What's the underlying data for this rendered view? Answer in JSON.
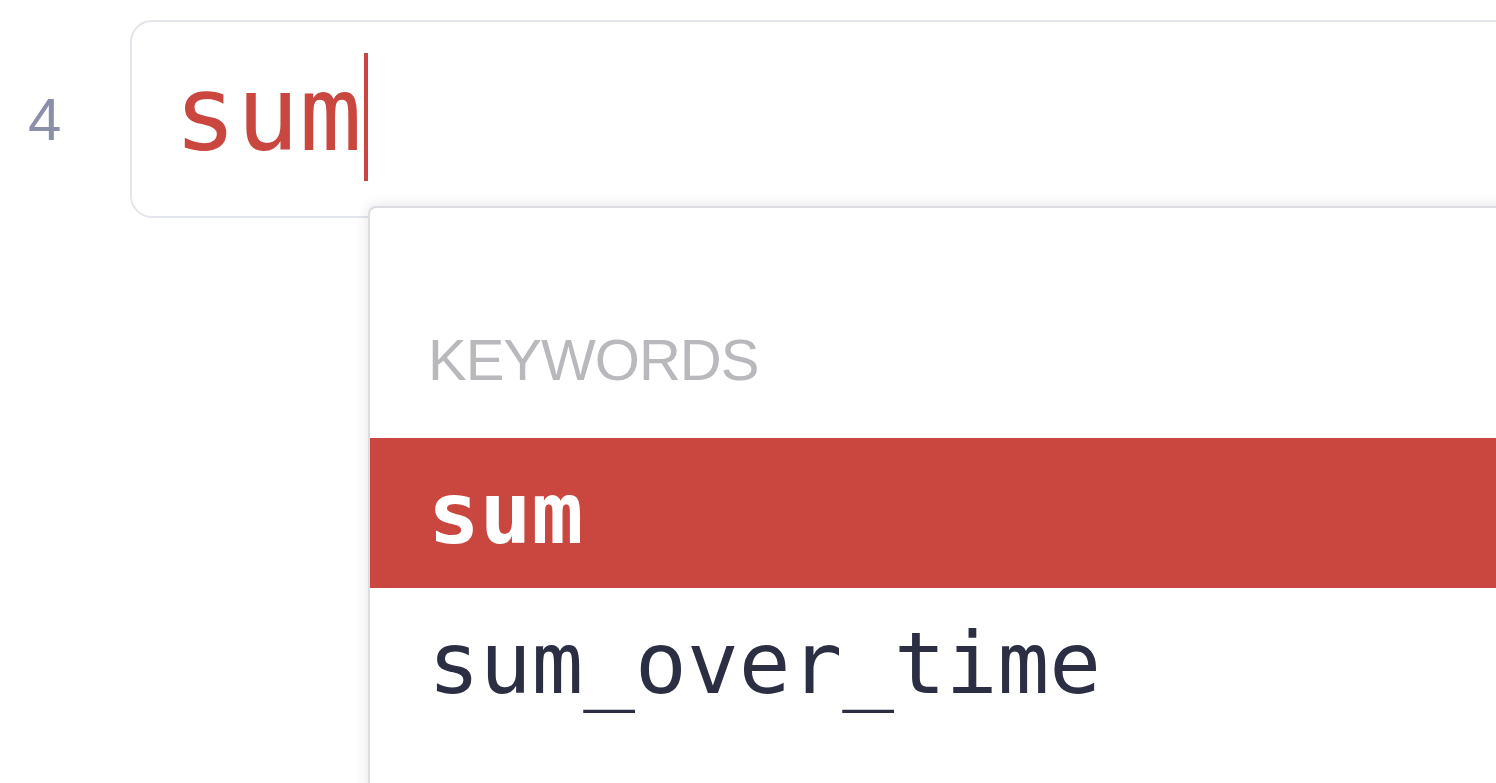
{
  "editor": {
    "line_number": "4",
    "query": {
      "value": "sum"
    }
  },
  "autocomplete": {
    "heading": "KEYWORDS",
    "items": [
      {
        "label": "sum",
        "selected": true
      },
      {
        "label": "sum_over_time",
        "selected": false
      }
    ]
  }
}
